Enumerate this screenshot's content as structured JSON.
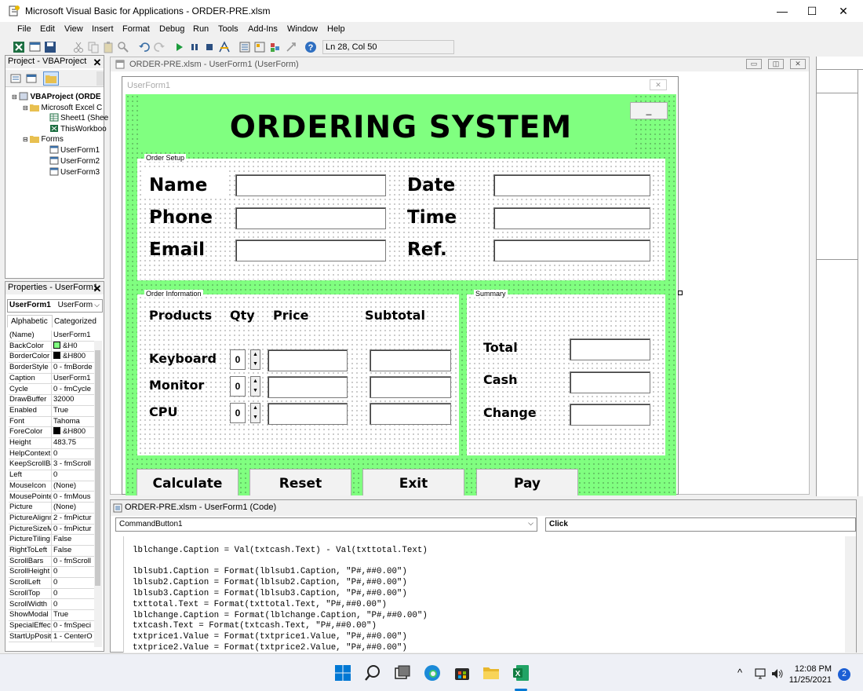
{
  "window": {
    "title": "Microsoft Visual Basic for Applications - ORDER-PRE.xlsm",
    "minimize": "—",
    "maximize": "☐",
    "close": "✕"
  },
  "menu": [
    "File",
    "Edit",
    "View",
    "Insert",
    "Format",
    "Debug",
    "Run",
    "Tools",
    "Add-Ins",
    "Window",
    "Help"
  ],
  "toolbar": {
    "position": "Ln 28, Col 50"
  },
  "project_pane": {
    "title": "Project - VBAProject",
    "close": "✕",
    "tree": [
      "VBAProject (ORDE",
      "Microsoft Excel C",
      "Sheet1 (Shee",
      "ThisWorkboo",
      "Forms",
      "UserForm1",
      "UserForm2",
      "UserForm3"
    ]
  },
  "properties_pane": {
    "title": "Properties - UserForm1",
    "close": "✕",
    "object_name": "UserForm1",
    "object_type": "UserForm",
    "tab_alpha": "Alphabetic",
    "tab_cat": "Categorized",
    "rows": [
      [
        "(Name)",
        "UserForm1"
      ],
      [
        "BackColor",
        "&H0"
      ],
      [
        "BorderColor",
        "&H800"
      ],
      [
        "BorderStyle",
        "0 - fmBorde"
      ],
      [
        "Caption",
        "UserForm1"
      ],
      [
        "Cycle",
        "0 - fmCycle"
      ],
      [
        "DrawBuffer",
        "32000"
      ],
      [
        "Enabled",
        "True"
      ],
      [
        "Font",
        "Tahoma"
      ],
      [
        "ForeColor",
        "&H800"
      ],
      [
        "Height",
        "483.75"
      ],
      [
        "HelpContextI",
        "0"
      ],
      [
        "KeepScrollBa",
        "3 - fmScroll"
      ],
      [
        "Left",
        "0"
      ],
      [
        "MouseIcon",
        "(None)"
      ],
      [
        "MousePointe",
        "0 - fmMous"
      ],
      [
        "Picture",
        "(None)"
      ],
      [
        "PictureAlignm",
        "2 - fmPictur"
      ],
      [
        "PictureSizeM",
        "0 - fmPictur"
      ],
      [
        "PictureTiling",
        "False"
      ],
      [
        "RightToLeft",
        "False"
      ],
      [
        "ScrollBars",
        "0 - fmScroll"
      ],
      [
        "ScrollHeight",
        "0"
      ],
      [
        "ScrollLeft",
        "0"
      ],
      [
        "ScrollTop",
        "0"
      ],
      [
        "ScrollWidth",
        "0"
      ],
      [
        "ShowModal",
        "True"
      ],
      [
        "SpecialEffect",
        "0 - fmSpeci"
      ],
      [
        "StartUpPosit",
        "1 - CenterO"
      ]
    ]
  },
  "designer": {
    "title": "ORDER-PRE.xlsm - UserForm1 (UserForm)",
    "form_caption": "UserForm1",
    "form_close": "✕",
    "min_button": "_",
    "heading": "ORDERING SYSTEM",
    "setup_caption": "Order Setup",
    "setup_labels": [
      "Name",
      "Phone",
      "Email",
      "Date",
      "Time",
      "Ref."
    ],
    "info_caption": "Order Information",
    "col_headers": [
      "Products",
      "Qty",
      "Price",
      "Subtotal"
    ],
    "products": [
      {
        "name": "Keyboard",
        "qty": "0"
      },
      {
        "name": "Monitor",
        "qty": "0"
      },
      {
        "name": "CPU",
        "qty": "0"
      }
    ],
    "summary_caption": "Summary",
    "summary_labels": [
      "Total",
      "Cash",
      "Change"
    ],
    "buttons": [
      "Calculate",
      "Reset",
      "Exit",
      "Pay"
    ]
  },
  "code_window": {
    "title": "ORDER-PRE.xlsm - UserForm1 (Code)",
    "object_combo": "CommandButton1",
    "proc_combo": "Click",
    "lines": [
      "lblchange.Caption = Val(txtcash.Text) - Val(txttotal.Text)",
      "",
      "lblsub1.Caption = Format(lblsub1.Caption, \"P#,##0.00\")",
      "lblsub2.Caption = Format(lblsub2.Caption, \"P#,##0.00\")",
      "lblsub3.Caption = Format(lblsub3.Caption, \"P#,##0.00\")",
      "txttotal.Text = Format(txttotal.Text, \"P#,##0.00\")",
      "lblchange.Caption = Format(lblchange.Caption, \"P#,##0.00\")",
      "txtcash.Text = Format(txtcash.Text, \"P#,##0.00\")",
      "txtprice1.Value = Format(txtprice1.Value, \"P#,##0.00\")",
      "txtprice2.Value = Format(txtprice2.Value, \"P#,##0.00\")"
    ]
  },
  "taskbar": {
    "time": "12:08 PM",
    "date": "11/25/2021",
    "badge": "2",
    "chevron": "^"
  },
  "colors": {
    "form_back": "#80ff80",
    "excel_green": "#1d6f42",
    "start_blue": "#0078d4"
  }
}
